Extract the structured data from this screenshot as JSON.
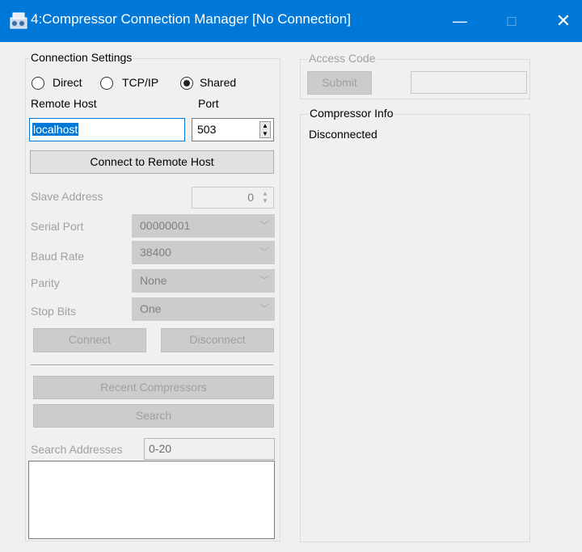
{
  "window": {
    "title": "4:Compressor Connection Manager [No Connection]",
    "minimize": "—",
    "maximize": "□",
    "close": "✕"
  },
  "connection": {
    "group_label": "Connection Settings",
    "radio_direct": "Direct",
    "radio_tcpip": "TCP/IP",
    "radio_shared": "Shared",
    "selected_mode": "Shared",
    "remote_host_label": "Remote Host",
    "port_label": "Port",
    "remote_host_value": "localhost",
    "port_value": "503",
    "connect_remote_button": "Connect to Remote Host",
    "slave_address_label": "Slave Address",
    "slave_address_value": "0",
    "serial_port_label": "Serial Port",
    "serial_port_value": "00000001",
    "baud_rate_label": "Baud Rate",
    "baud_rate_value": "38400",
    "parity_label": "Parity",
    "parity_value": "None",
    "stop_bits_label": "Stop Bits",
    "stop_bits_value": "One",
    "connect_button": "Connect",
    "disconnect_button": "Disconnect",
    "recent_compressors_button": "Recent Compressors",
    "search_button": "Search",
    "search_addresses_label": "Search Addresses",
    "search_addresses_value": "0-20"
  },
  "access_code": {
    "group_label": "Access Code",
    "submit_button": "Submit",
    "code_value": ""
  },
  "compressor_info": {
    "group_label": "Compressor Info",
    "status": "Disconnected"
  }
}
